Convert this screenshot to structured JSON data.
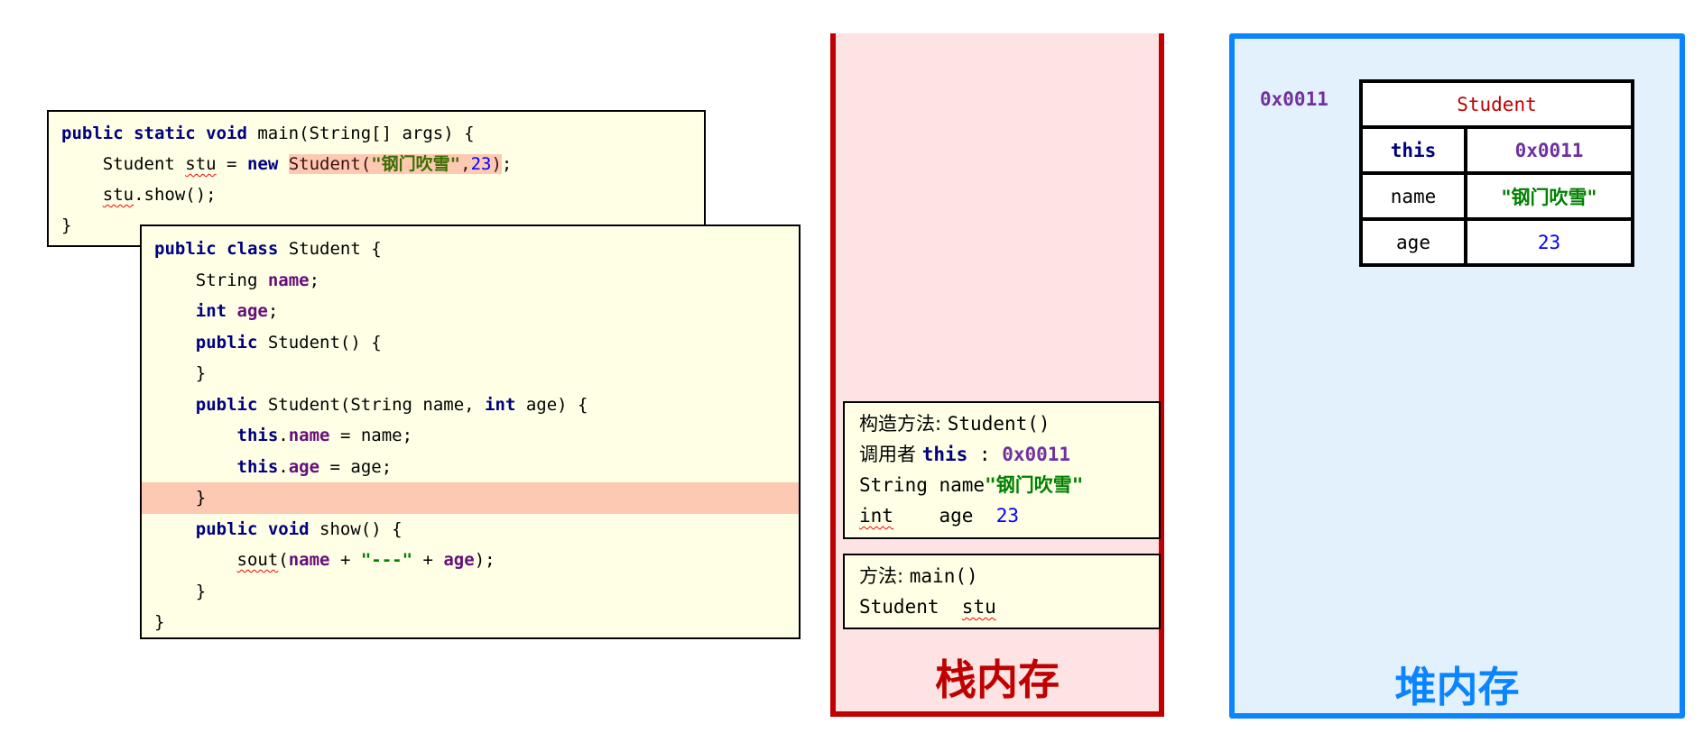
{
  "main_method": {
    "lines": [
      {
        "parts": [
          {
            "t": "public static void ",
            "c": "kw"
          },
          {
            "t": "main(String[] args) {",
            "c": ""
          }
        ]
      },
      {
        "parts": [
          {
            "t": "    Student ",
            "c": ""
          },
          {
            "t": "stu",
            "c": "squiggle"
          },
          {
            "t": " = ",
            "c": ""
          },
          {
            "t": "new",
            "c": "kw"
          },
          {
            "t": " ",
            "c": ""
          },
          {
            "t": "Student(",
            "c": "ctor hl-span"
          },
          {
            "t": "\"钢门吹雪\"",
            "c": "str-dark hl-span"
          },
          {
            "t": ",",
            "c": "ctor hl-span"
          },
          {
            "t": "23",
            "c": "num hl-span"
          },
          {
            "t": ")",
            "c": "ctor hl-span"
          },
          {
            "t": ";",
            "c": ""
          }
        ]
      },
      {
        "parts": [
          {
            "t": "    ",
            "c": ""
          },
          {
            "t": "stu",
            "c": "squiggle"
          },
          {
            "t": ".show();",
            "c": ""
          }
        ]
      },
      {
        "parts": [
          {
            "t": "}",
            "c": ""
          }
        ]
      }
    ]
  },
  "student_class": {
    "highlight_line": 8,
    "lines": [
      {
        "parts": [
          {
            "t": "public class ",
            "c": "kw"
          },
          {
            "t": "Student {",
            "c": ""
          }
        ]
      },
      {
        "parts": [
          {
            "t": "    String ",
            "c": ""
          },
          {
            "t": "name",
            "c": "field"
          },
          {
            "t": ";",
            "c": ""
          }
        ]
      },
      {
        "parts": [
          {
            "t": "    ",
            "c": ""
          },
          {
            "t": "int ",
            "c": "kw"
          },
          {
            "t": "age",
            "c": "field"
          },
          {
            "t": ";",
            "c": ""
          }
        ]
      },
      {
        "parts": [
          {
            "t": "    ",
            "c": ""
          },
          {
            "t": "public ",
            "c": "kw"
          },
          {
            "t": "Student() {",
            "c": ""
          }
        ]
      },
      {
        "parts": [
          {
            "t": "    }",
            "c": ""
          }
        ]
      },
      {
        "parts": [
          {
            "t": "    ",
            "c": ""
          },
          {
            "t": "public ",
            "c": "kw"
          },
          {
            "t": "Student(String name, ",
            "c": ""
          },
          {
            "t": "int ",
            "c": "kw"
          },
          {
            "t": "age) {",
            "c": ""
          }
        ]
      },
      {
        "parts": [
          {
            "t": "        ",
            "c": ""
          },
          {
            "t": "this",
            "c": "kw"
          },
          {
            "t": ".",
            "c": ""
          },
          {
            "t": "name",
            "c": "field"
          },
          {
            "t": " = name;",
            "c": ""
          }
        ]
      },
      {
        "parts": [
          {
            "t": "        ",
            "c": ""
          },
          {
            "t": "this",
            "c": "kw"
          },
          {
            "t": ".",
            "c": ""
          },
          {
            "t": "age",
            "c": "field"
          },
          {
            "t": " = age;",
            "c": ""
          }
        ]
      },
      {
        "parts": [
          {
            "t": "    }",
            "c": ""
          }
        ]
      },
      {
        "parts": [
          {
            "t": "    ",
            "c": ""
          },
          {
            "t": "public void ",
            "c": "kw"
          },
          {
            "t": "show() {",
            "c": ""
          }
        ]
      },
      {
        "parts": [
          {
            "t": "        ",
            "c": ""
          },
          {
            "t": "sout",
            "c": "squiggle"
          },
          {
            "t": "(",
            "c": ""
          },
          {
            "t": "name",
            "c": "field"
          },
          {
            "t": " + ",
            "c": ""
          },
          {
            "t": "\"---\"",
            "c": "str"
          },
          {
            "t": " + ",
            "c": ""
          },
          {
            "t": "age",
            "c": "field"
          },
          {
            "t": ");",
            "c": ""
          }
        ]
      },
      {
        "parts": [
          {
            "t": "    }",
            "c": ""
          }
        ]
      },
      {
        "parts": [
          {
            "t": "}",
            "c": ""
          }
        ]
      }
    ]
  },
  "stack": {
    "label": "栈内存",
    "frames": [
      {
        "id": "ctor",
        "lines": [
          {
            "parts": [
              {
                "t": "构造方法: ",
                "c": "cjk"
              },
              {
                "t": "Student()",
                "c": ""
              }
            ]
          },
          {
            "parts": [
              {
                "t": "调用者 ",
                "c": "cjk"
              },
              {
                "t": "this",
                "c": "kw"
              },
              {
                "t": " : ",
                "c": ""
              },
              {
                "t": "0x0011",
                "c": "addr"
              }
            ]
          },
          {
            "parts": [
              {
                "t": "String name",
                "c": ""
              },
              {
                "t": "\"钢门吹雪\"",
                "c": "str"
              }
            ]
          },
          {
            "parts": [
              {
                "t": "int",
                "c": "squiggle"
              },
              {
                "t": "    age  ",
                "c": ""
              },
              {
                "t": "23",
                "c": "num"
              }
            ]
          }
        ]
      },
      {
        "id": "main",
        "lines": [
          {
            "parts": [
              {
                "t": "方法: ",
                "c": "cjk"
              },
              {
                "t": "main()",
                "c": ""
              }
            ]
          },
          {
            "parts": [
              {
                "t": "Student  ",
                "c": ""
              },
              {
                "t": "stu",
                "c": "squiggle"
              }
            ]
          }
        ]
      }
    ]
  },
  "heap": {
    "label": "堆内存",
    "object_address": "0x0011",
    "object": {
      "class_name": "Student",
      "fields": [
        {
          "name": "this",
          "value": "0x0011",
          "name_style": "kw",
          "value_style": "addr"
        },
        {
          "name": "name",
          "value": "\"钢门吹雪\"",
          "name_style": "",
          "value_style": "str"
        },
        {
          "name": "age",
          "value": "23",
          "name_style": "",
          "value_style": "num"
        }
      ]
    }
  },
  "colors": {
    "stack_border": "#c00000",
    "stack_bg": "#fde3e4",
    "heap_border": "#0a84ff",
    "heap_bg": "#e3f1fd",
    "code_bg": "#ffffe6",
    "highlight": "#fdc9b3",
    "address": "#7030a0"
  }
}
